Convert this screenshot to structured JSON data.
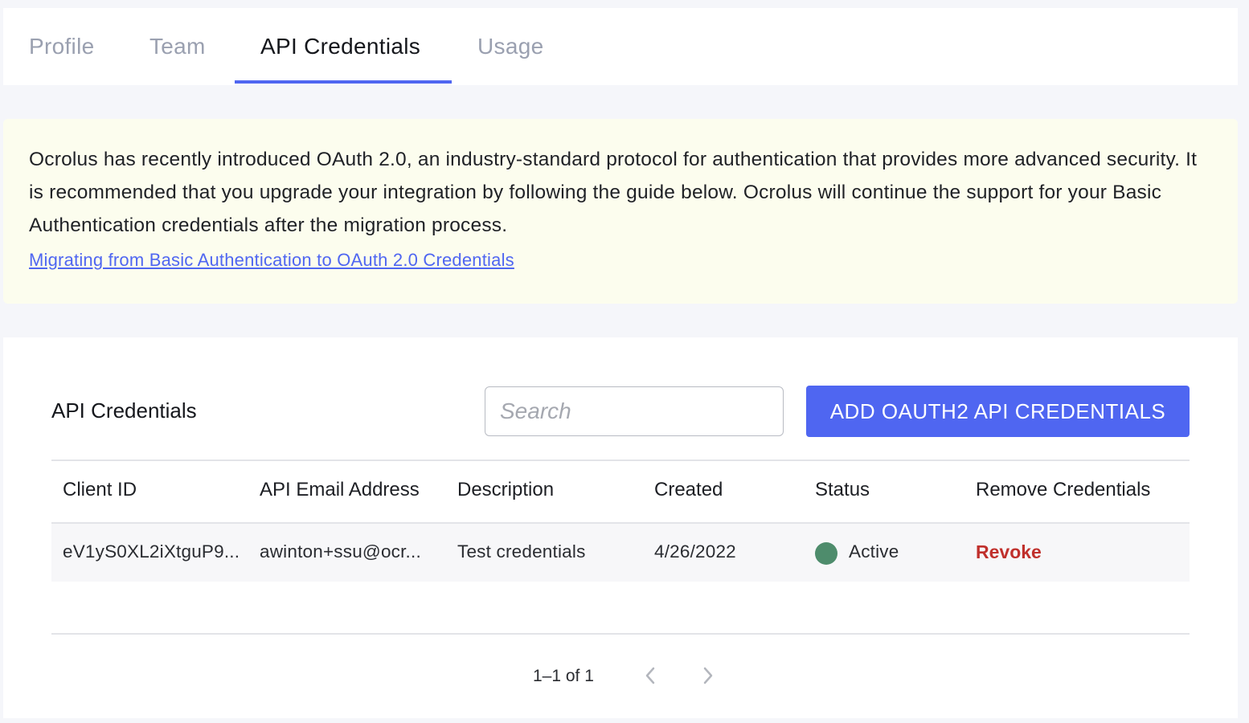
{
  "tabs": [
    {
      "label": "Profile"
    },
    {
      "label": "Team"
    },
    {
      "label": "API Credentials"
    },
    {
      "label": "Usage"
    }
  ],
  "notice": {
    "text": "Ocrolus has recently introduced OAuth 2.0, an industry-standard protocol for authentication that provides more advanced security. It is recommended that you upgrade your integration by following the guide below. Ocrolus will continue the support for your Basic Authentication credentials after the migration process.",
    "link_text": "Migrating from Basic Authentication to OAuth 2.0 Credentials"
  },
  "panel": {
    "title": "API Credentials",
    "search_placeholder": "Search",
    "add_button_label": "ADD OAUTH2 API CREDENTIALS"
  },
  "table": {
    "headers": [
      "Client ID",
      "API Email Address",
      "Description",
      "Created",
      "Status",
      "Remove Credentials"
    ],
    "rows": [
      {
        "client_id": "eV1yS0XL2iXtguP9...",
        "email": "awinton+ssu@ocr...",
        "description": "Test credentials",
        "created": "4/26/2022",
        "status": "Active",
        "action": "Revoke"
      }
    ]
  },
  "pagination": {
    "range_text": "1–1 of 1"
  },
  "colors": {
    "accent": "#4f66f1",
    "status_active": "#4e8c6c",
    "revoke": "#c0302c",
    "notice_bg": "#fcfdee"
  }
}
